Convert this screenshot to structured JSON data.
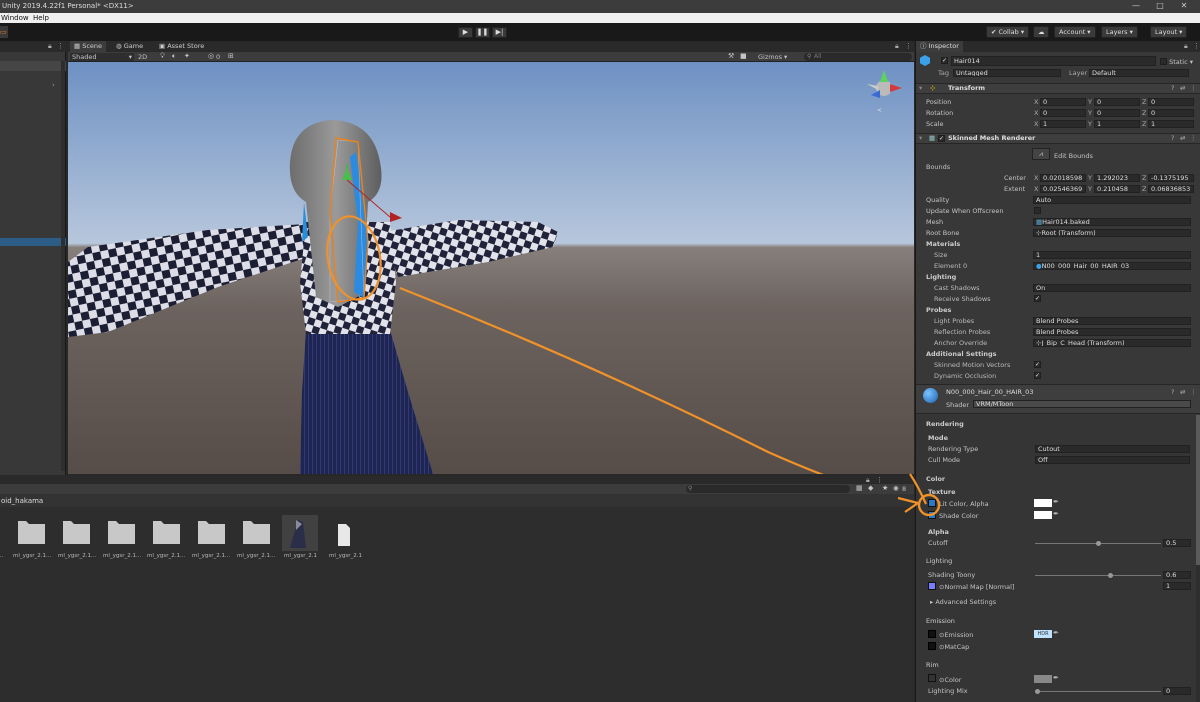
{
  "window": {
    "title": "Unity 2019.4.22f1 Personal* <DX11>",
    "minimize": "—",
    "maximize": "□",
    "close": "✕"
  },
  "menu": {
    "items": [
      "Window",
      "Help"
    ]
  },
  "toolbar": {
    "collab": "Collab ▾",
    "account": "Account ▾",
    "layers": "Layers ▾",
    "layout": "Layout ▾",
    "play": "▶",
    "pause": "❚❚",
    "step": "▶|"
  },
  "scene": {
    "tabs": [
      "Scene",
      "Game",
      "Asset Store"
    ],
    "shading": "Shaded",
    "mode2d": "2D",
    "gizmos": "Gizmos ▾",
    "search_placeholder": "All",
    "zero_count": "0"
  },
  "project": {
    "path": "oid_hakama",
    "items": [
      "ml_ygsr_2.1...",
      "ml_ygsr_2.1...",
      "ml_ygsr_2.1...",
      "ml_ygsr_2.1...",
      "ml_ygsr_2.1...",
      "ml_ygsr_2.1...",
      "ml_ygsr_2.1",
      "ml_ygsr_2.1"
    ],
    "count": "8"
  },
  "inspector": {
    "tab": "Inspector",
    "object_name": "Hair014",
    "static_label": "Static ▾",
    "tag_label": "Tag",
    "tag_value": "Untagged",
    "layer_label": "Layer",
    "layer_value": "Default",
    "transform": {
      "title": "Transform",
      "rows": [
        {
          "label": "Position",
          "x": "0",
          "y": "0",
          "z": "0"
        },
        {
          "label": "Rotation",
          "x": "0",
          "y": "0",
          "z": "0"
        },
        {
          "label": "Scale",
          "x": "1",
          "y": "1",
          "z": "1"
        }
      ]
    },
    "smr": {
      "title": "Skinned Mesh Renderer",
      "edit_bounds": "Edit Bounds",
      "bounds": "Bounds",
      "center_label": "Center",
      "center": {
        "x": "0.02018598",
        "y": "1.292023",
        "z": "-0.1375195"
      },
      "extent_label": "Extent",
      "extent": {
        "x": "0.02546369",
        "y": "0.210458",
        "z": "0.06836853"
      },
      "quality_label": "Quality",
      "quality_value": "Auto",
      "update_offscreen": "Update When Offscreen",
      "mesh_label": "Mesh",
      "mesh_value": "Hair014.baked",
      "root_bone_label": "Root Bone",
      "root_bone_value": "Root (Transform)",
      "materials": "Materials",
      "size_label": "Size",
      "size_value": "1",
      "element_label": "Element 0",
      "element_value": "N00_000_Hair_00_HAIR_03",
      "lighting": "Lighting",
      "cast_shadows_label": "Cast Shadows",
      "cast_shadows_value": "On",
      "receive_shadows": "Receive Shadows",
      "probes": "Probes",
      "light_probes_label": "Light Probes",
      "light_probes_value": "Blend Probes",
      "reflection_probes_label": "Reflection Probes",
      "reflection_probes_value": "Blend Probes",
      "anchor_label": "Anchor Override",
      "anchor_value": "J_Bip_C_Head (Transform)",
      "additional": "Additional Settings",
      "skinned_motion": "Skinned Motion Vectors",
      "dynamic_occlusion": "Dynamic Occlusion"
    },
    "material": {
      "name": "N00_000_Hair_00_HAIR_03",
      "shader_label": "Shader",
      "shader_value": "VRM/MToon",
      "rendering": "Rendering",
      "mode": "Mode",
      "rendering_type_label": "Rendering Type",
      "rendering_type_value": "Cutout",
      "cull_mode_label": "Cull Mode",
      "cull_mode_value": "Off",
      "color": "Color",
      "texture": "Texture",
      "lit_color": "Lit Color, Alpha",
      "shade_color": "Shade Color",
      "alpha": "Alpha",
      "cutoff_label": "Cutoff",
      "cutoff_value": "0.5",
      "lighting": "Lighting",
      "shading_toony_label": "Shading Toony",
      "shading_toony_value": "0.6",
      "normal_map_label": "Normal Map [Normal]",
      "normal_map_value": "1",
      "advanced": "Advanced Settings",
      "emission": "Emission",
      "emission_label": "Emission",
      "hdr": "HDR",
      "matcap_label": "MatCap",
      "rim": "Rim",
      "rim_color_label": "Color",
      "lighting_mix_label": "Lighting Mix",
      "lighting_mix_value": "0"
    }
  },
  "annotation": {
    "color": "#f0922a"
  },
  "colors": {
    "accent": "#2c5d87",
    "panel": "#383838",
    "dark": "#191919"
  }
}
